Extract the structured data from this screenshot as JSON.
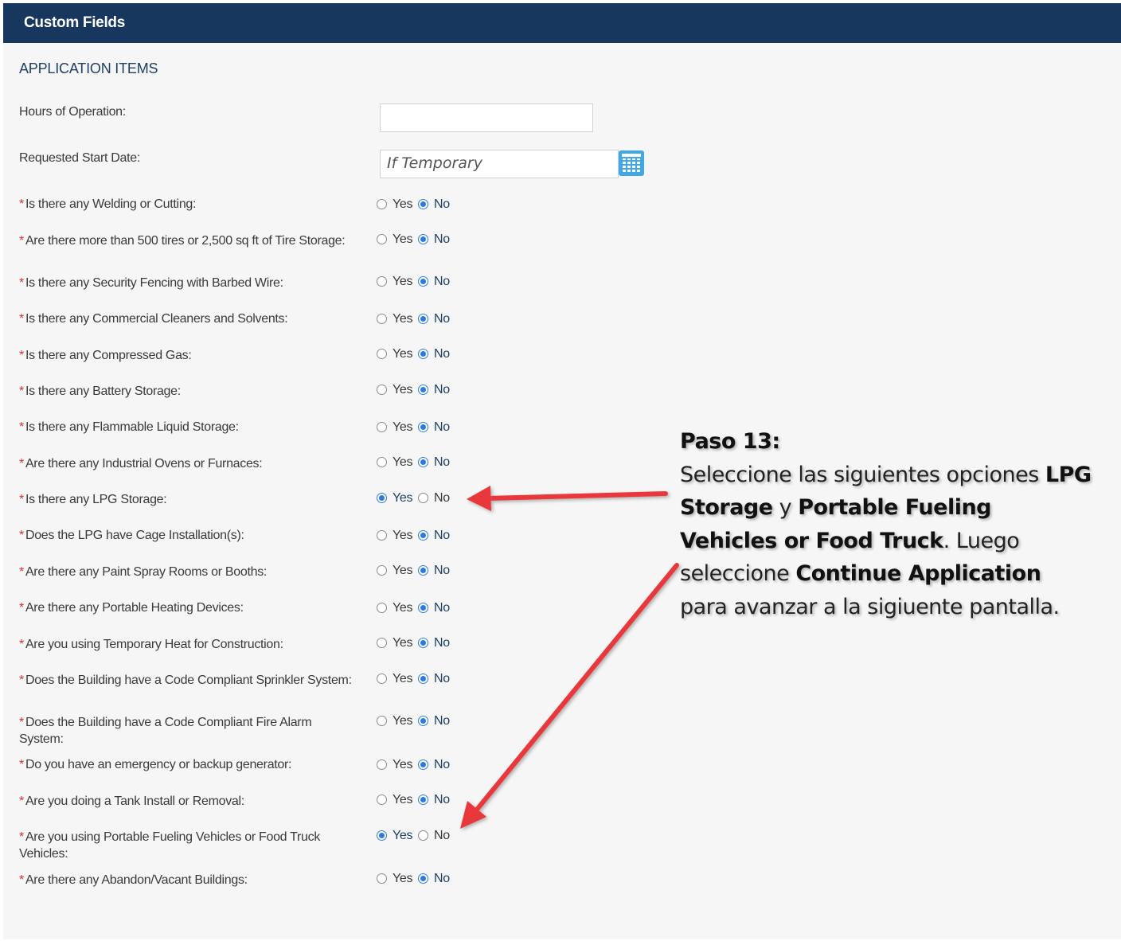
{
  "header": {
    "title": "Custom Fields"
  },
  "section": {
    "title": "APPLICATION ITEMS"
  },
  "fields": {
    "hours": {
      "label": "Hours of Operation:",
      "value": ""
    },
    "start_date": {
      "label": "Requested Start Date:",
      "placeholder": "If Temporary",
      "calendar_icon": "calendar-icon"
    }
  },
  "radio_options": {
    "yes": "Yes",
    "no": "No"
  },
  "questions": [
    {
      "label": "Is there any Welding or Cutting:",
      "required": "*",
      "selected": "No"
    },
    {
      "label": "Are there more than 500 tires or 2,500 sq ft of Tire Storage:",
      "required": "*",
      "selected": "No"
    },
    {
      "label": "Is there any Security Fencing with Barbed Wire:",
      "required": "*",
      "selected": "No"
    },
    {
      "label": "Is there any Commercial Cleaners and Solvents:",
      "required": "*",
      "selected": "No"
    },
    {
      "label": "Is there any Compressed Gas:",
      "required": "*",
      "selected": "No"
    },
    {
      "label": "Is there any Battery Storage:",
      "required": "*",
      "selected": "No"
    },
    {
      "label": "Is there any Flammable Liquid Storage:",
      "required": "*",
      "selected": "No"
    },
    {
      "label": "Are there any Industrial Ovens or Furnaces:",
      "required": "*",
      "selected": "No"
    },
    {
      "label": "Is there any LPG Storage:",
      "required": "*",
      "selected": "Yes"
    },
    {
      "label": "Does the LPG have Cage Installation(s):",
      "required": "*",
      "selected": "No"
    },
    {
      "label": "Are there any Paint Spray Rooms or Booths:",
      "required": "*",
      "selected": "No"
    },
    {
      "label": "Are there any Portable Heating Devices:",
      "required": "*",
      "selected": "No"
    },
    {
      "label": "Are you using Temporary Heat for Construction:",
      "required": "*",
      "selected": "No"
    },
    {
      "label": "Does the Building have a Code Compliant Sprinkler System:",
      "required": "*",
      "selected": "No"
    },
    {
      "label": "Does the Building have a Code Compliant Fire Alarm System:",
      "required": "*",
      "selected": "No"
    },
    {
      "label": "Do you have an emergency or backup generator:",
      "required": "*",
      "selected": "No"
    },
    {
      "label": "Are you doing a Tank Install or Removal:",
      "required": "*",
      "selected": "No"
    },
    {
      "label": "Are you using Portable Fueling Vehicles or Food Truck Vehicles:",
      "required": "*",
      "selected": "Yes"
    },
    {
      "label": "Are there any Abandon/Vacant Buildings:",
      "required": "*",
      "selected": "No"
    }
  ],
  "annotation": {
    "title": "Paso 13:",
    "t1": "Seleccione las siguientes opciones ",
    "b1": "LPG Storage",
    "t2": " y ",
    "b2": "Portable Fueling Vehicles or Food Truck",
    "t3": ". Luego seleccione ",
    "b3": "Continue Application",
    "t4": " para avanzar a la sigiuente pantalla.",
    "arrow_color": "#e8383b"
  },
  "colors": {
    "header_bg": "#17375e",
    "accent": "#2a7ae2",
    "required": "#d0312d"
  }
}
